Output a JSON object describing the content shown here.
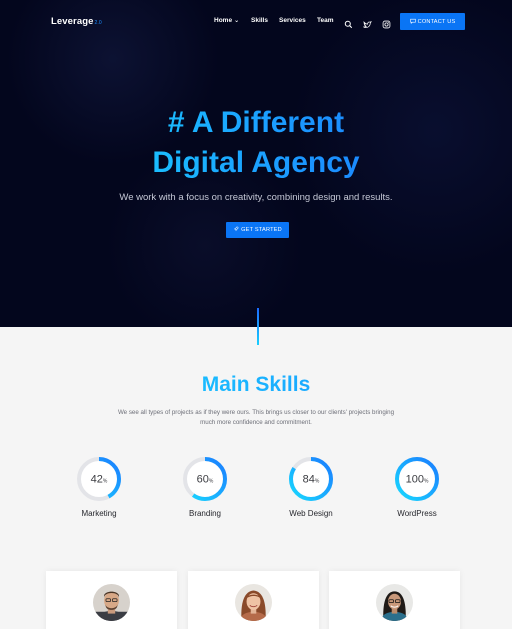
{
  "nav": {
    "logo": "Leverage",
    "logo_version": "2.0",
    "items": [
      {
        "label": "Home"
      },
      {
        "label": "Skills"
      },
      {
        "label": "Services"
      },
      {
        "label": "Team"
      }
    ],
    "icons": [
      "search-icon",
      "twitter-icon",
      "instagram-icon"
    ],
    "contact_label": "CONTACT US"
  },
  "hero": {
    "title_line1": "# A Different",
    "title_line2": "Digital Agency",
    "subtitle": "We work with a focus on creativity, combining design and results.",
    "cta_label": "GET STARTED"
  },
  "skills": {
    "title": "Main Skills",
    "description_line1": "We see all types of projects as if they were ours. This brings us closer to our clients' projects bringing",
    "description_line2": "much more confidence and commitment.",
    "items": [
      {
        "value": "42",
        "unit": "%",
        "label": "Marketing",
        "percent": 42
      },
      {
        "value": "60",
        "unit": "%",
        "label": "Branding",
        "percent": 60
      },
      {
        "value": "84",
        "unit": "%",
        "label": "Web Design",
        "percent": 84
      },
      {
        "value": "100",
        "unit": "%",
        "label": "WordPress",
        "percent": 100
      }
    ]
  },
  "colors": {
    "hero_bg": "#03061d",
    "accent": "#0a75f5",
    "gradient_start": "#19e6ff",
    "gradient_end": "#1b6cff",
    "page_bg": "#f5f5f5"
  }
}
